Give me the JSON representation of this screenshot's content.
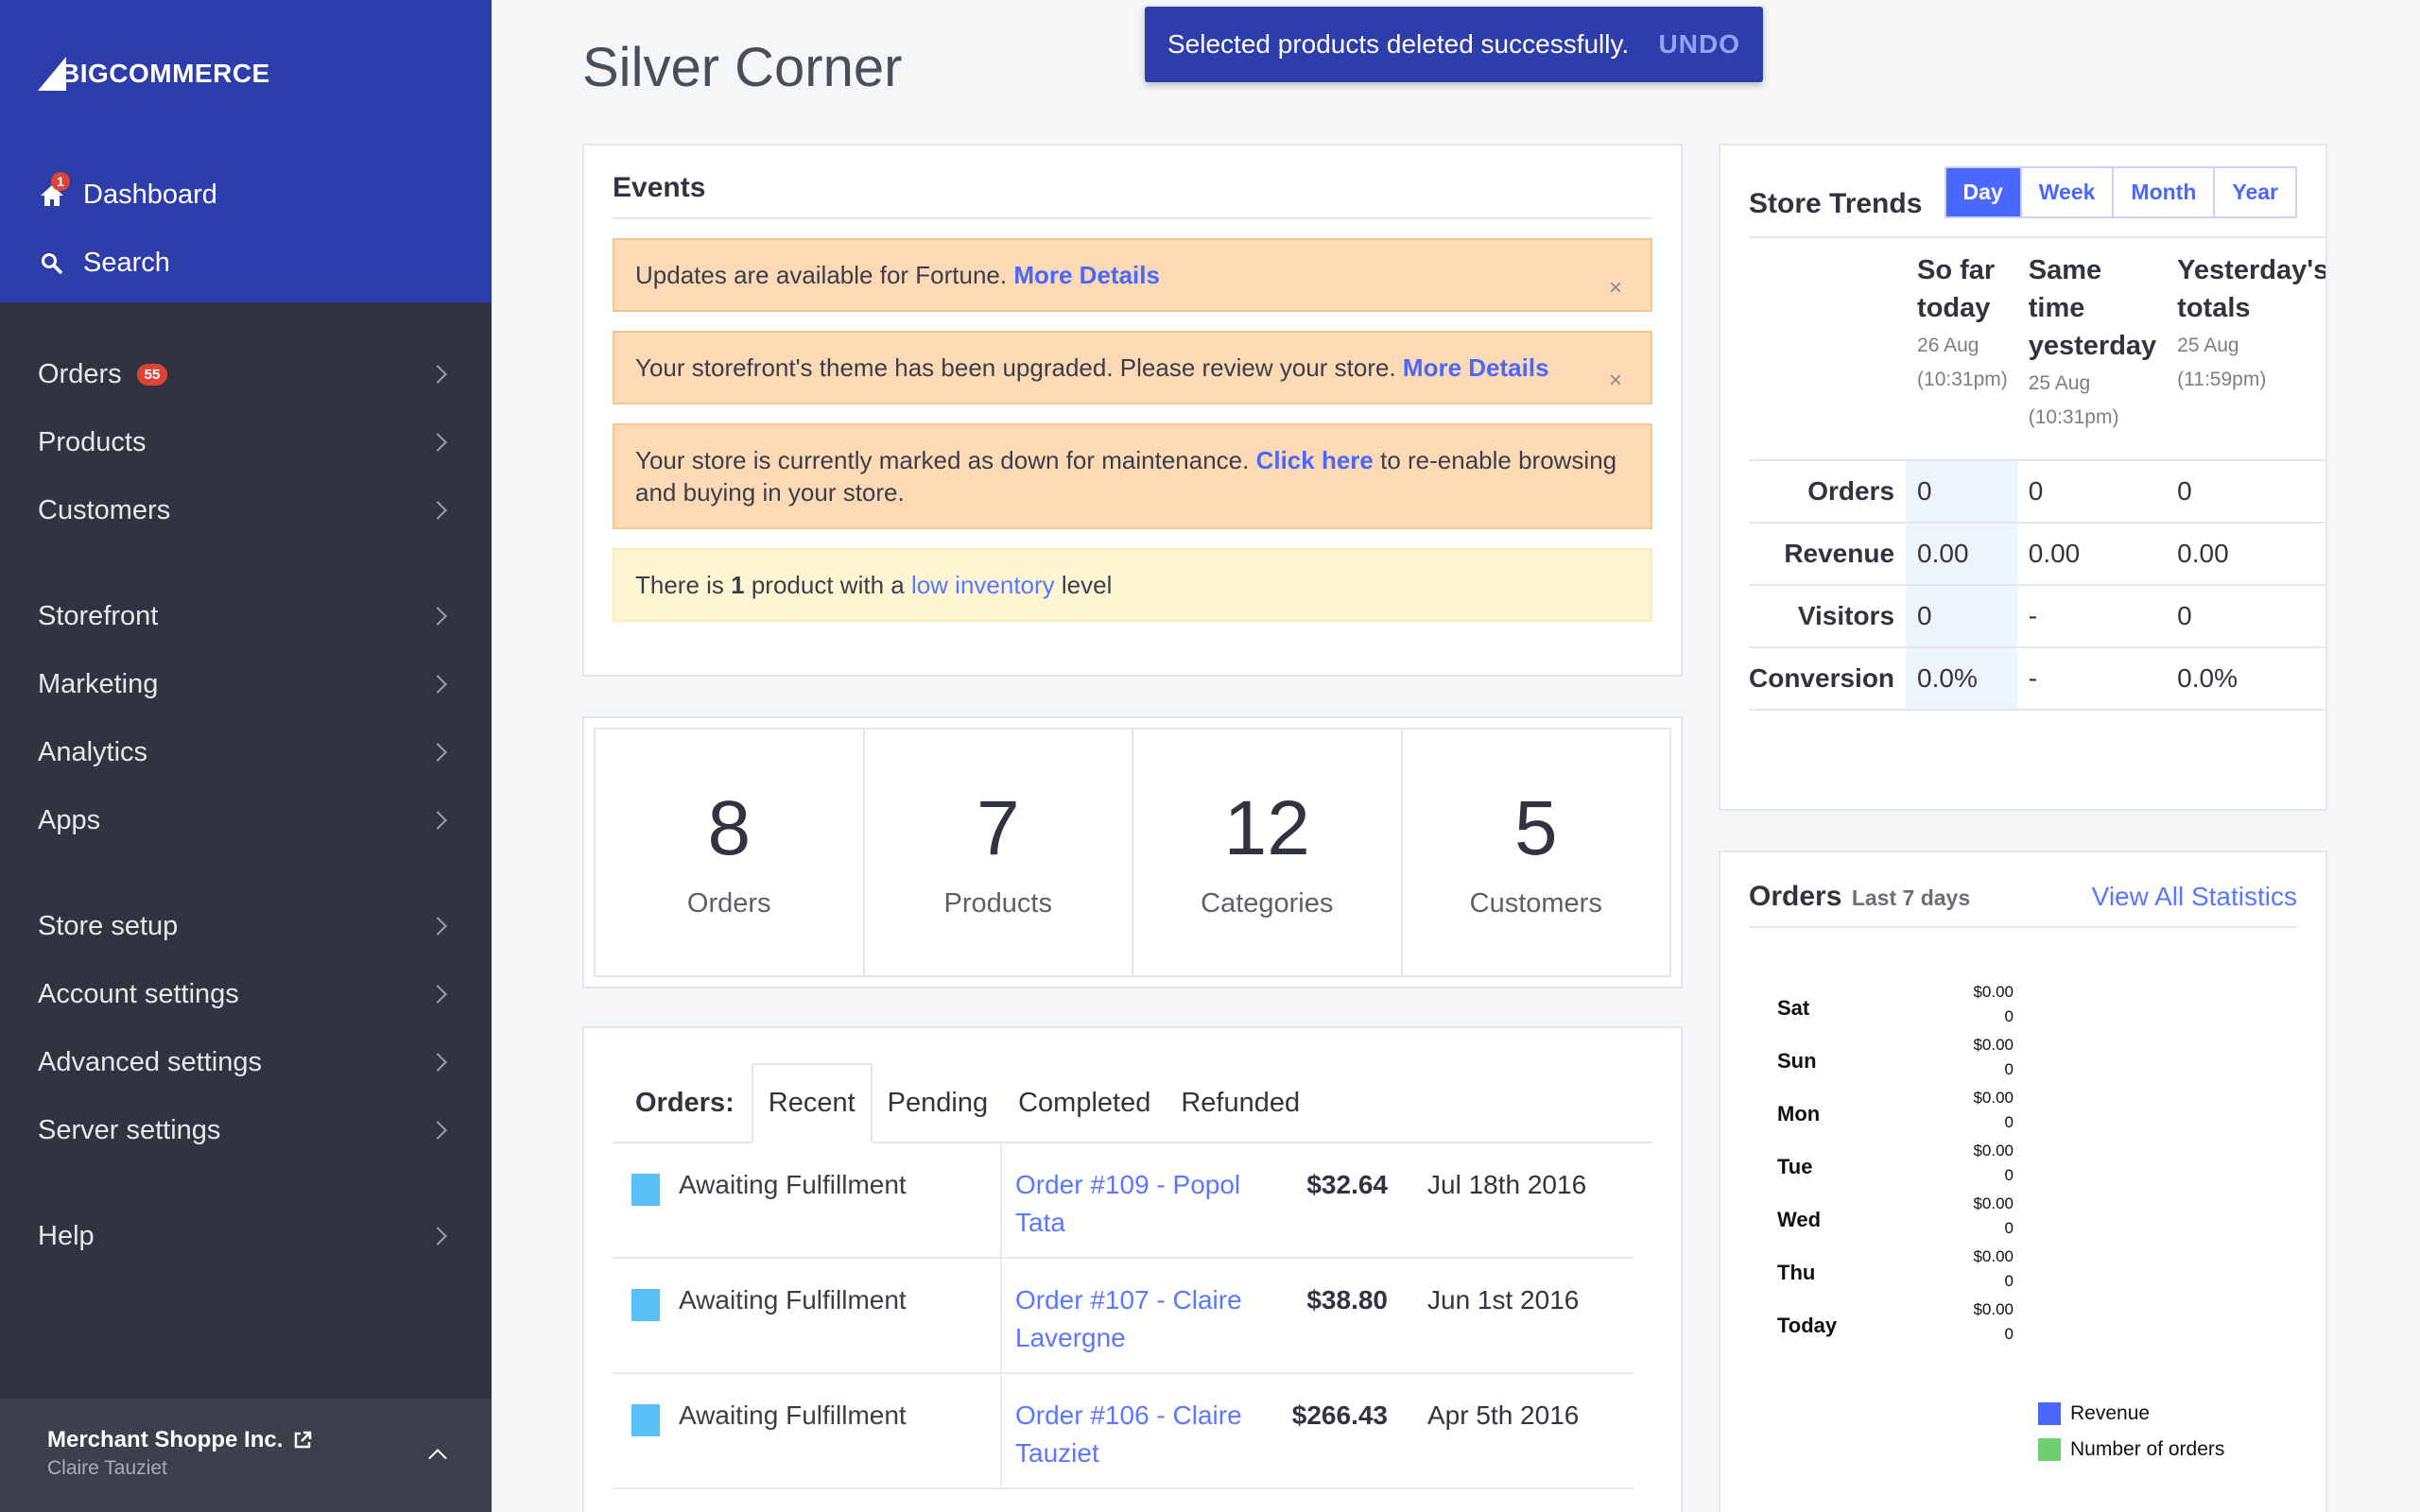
{
  "brand": {
    "logo_text": "BIGCOMMERCE"
  },
  "sidebar": {
    "top_items": [
      {
        "label": "Dashboard",
        "notification": "1"
      },
      {
        "label": "Search"
      }
    ],
    "nav_groups": [
      [
        {
          "label": "Orders",
          "badge": "55"
        },
        {
          "label": "Products"
        },
        {
          "label": "Customers"
        }
      ],
      [
        {
          "label": "Storefront"
        },
        {
          "label": "Marketing"
        },
        {
          "label": "Analytics"
        },
        {
          "label": "Apps"
        }
      ],
      [
        {
          "label": "Store setup"
        },
        {
          "label": "Account settings"
        },
        {
          "label": "Advanced settings"
        },
        {
          "label": "Server settings"
        }
      ],
      [
        {
          "label": "Help"
        }
      ]
    ],
    "merchant": {
      "name": "Merchant Shoppe Inc.",
      "user": "Claire Tauziet"
    }
  },
  "toast": {
    "message": "Selected products deleted successfully.",
    "action": "UNDO"
  },
  "page": {
    "title": "Silver Corner"
  },
  "events": {
    "title": "Events",
    "alerts": [
      {
        "text": "Updates are available for Fortune. ",
        "link": "More Details",
        "after": ""
      },
      {
        "text": "Your storefront's theme has been upgraded. Please review your store. ",
        "link": "More Details",
        "after": ""
      },
      {
        "text": "Your store is currently marked as down for maintenance. ",
        "link": "Click here",
        "after": " to re-enable browsing and buying in your store."
      }
    ],
    "inventory": {
      "before": "There is ",
      "count": "1",
      "middle": " product with a ",
      "link": "low inventory",
      "after": " level"
    },
    "close_symbol": "×"
  },
  "stats": [
    {
      "value": "8",
      "label": "Orders"
    },
    {
      "value": "7",
      "label": "Products"
    },
    {
      "value": "12",
      "label": "Categories"
    },
    {
      "value": "5",
      "label": "Customers"
    }
  ],
  "orders_panel": {
    "label": "Orders:",
    "tabs": [
      "Recent",
      "Pending",
      "Completed",
      "Refunded"
    ],
    "active_tab": "Recent",
    "rows": [
      {
        "status": "Awaiting Fulfillment",
        "order": "Order #109 - Popol Tata",
        "amount": "$32.64",
        "date": "Jul 18th 2016"
      },
      {
        "status": "Awaiting Fulfillment",
        "order": "Order #107 - Claire Lavergne",
        "amount": "$38.80",
        "date": "Jun 1st 2016"
      },
      {
        "status": "Awaiting Fulfillment",
        "order": "Order #106 - Claire Tauziet",
        "amount": "$266.43",
        "date": "Apr 5th 2016"
      }
    ],
    "status_color": "#5bc0f8"
  },
  "store_trends": {
    "title": "Store Trends",
    "periods": [
      "Day",
      "Week",
      "Month",
      "Year"
    ],
    "active_period": "Day",
    "columns": [
      {
        "title": "So far today",
        "date": "26 Aug",
        "time": "(10:31pm)"
      },
      {
        "title": "Same time yesterday",
        "date": "25 Aug",
        "time": "(10:31pm)"
      },
      {
        "title": "Yesterday's totals",
        "date": "25 Aug",
        "time": "(11:59pm)"
      }
    ],
    "rows": [
      {
        "label": "Orders",
        "values": [
          "0",
          "0",
          "0"
        ]
      },
      {
        "label": "Revenue",
        "values": [
          "0.00",
          "0.00",
          "0.00"
        ]
      },
      {
        "label": "Visitors",
        "values": [
          "0",
          "-",
          "0"
        ]
      },
      {
        "label": "Conversion",
        "values": [
          "0.0%",
          "-",
          "0.0%"
        ]
      }
    ]
  },
  "orders_chart": {
    "title": "Orders",
    "subtitle": "Last 7 days",
    "link": "View All Statistics",
    "days": [
      {
        "day": "Sat",
        "revenue": "$0.00",
        "orders": "0"
      },
      {
        "day": "Sun",
        "revenue": "$0.00",
        "orders": "0"
      },
      {
        "day": "Mon",
        "revenue": "$0.00",
        "orders": "0"
      },
      {
        "day": "Tue",
        "revenue": "$0.00",
        "orders": "0"
      },
      {
        "day": "Wed",
        "revenue": "$0.00",
        "orders": "0"
      },
      {
        "day": "Thu",
        "revenue": "$0.00",
        "orders": "0"
      },
      {
        "day": "Today",
        "revenue": "$0.00",
        "orders": "0"
      }
    ],
    "legend": [
      {
        "label": "Revenue",
        "color": "#4a68ff"
      },
      {
        "label": "Number of orders",
        "color": "#6fcf6f"
      }
    ]
  },
  "colors": {
    "sidebar": "#313440",
    "sidebar_top": "#2d3eaa",
    "accent": "#4a68ff",
    "alert": "#fdd9b5",
    "notice": "#fef6d3",
    "badge": "#db4437"
  }
}
